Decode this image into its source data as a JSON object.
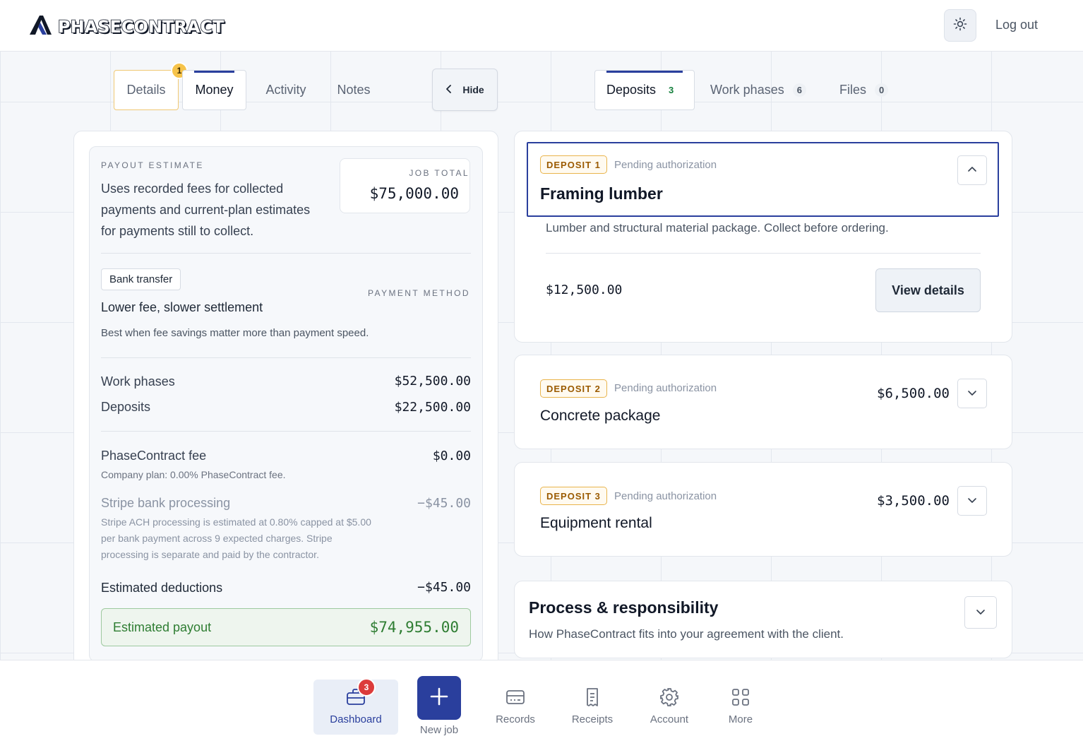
{
  "header": {
    "brand": "PHASECONTRACT",
    "logout": "Log out"
  },
  "left_tabs": {
    "details": "Details",
    "details_badge": "1",
    "money": "Money",
    "activity": "Activity",
    "notes": "Notes"
  },
  "hide_label": "Hide",
  "right_tabs": {
    "deposits": "Deposits",
    "deposits_count": "3",
    "work_phases": "Work phases",
    "work_phases_count": "6",
    "files": "Files",
    "files_count": "0"
  },
  "estimate": {
    "eyebrow": "PAYOUT ESTIMATE",
    "desc_1": "Uses recorded fees for collected",
    "desc_2": "payments and current-plan estimates",
    "desc_3": "for payments still to collect.",
    "job_total_label": "JOB TOTAL",
    "job_total": "$75,000.00",
    "method_chip": "Bank transfer",
    "method_eyebrow": "PAYMENT METHOD",
    "method_title": "Lower fee, slower settlement",
    "method_desc": "Best when fee savings matter more than payment speed.",
    "work_phases_label": "Work phases",
    "work_phases_value": "$52,500.00",
    "deposits_label": "Deposits",
    "deposits_value": "$22,500.00",
    "fee_label": "PhaseContract fee",
    "fee_value": "$0.00",
    "fee_note": "Company plan: 0.00% PhaseContract fee.",
    "stripe_label": "Stripe bank processing",
    "stripe_value": "−$45.00",
    "stripe_note_1": "Stripe ACH processing is estimated at 0.80% capped at $5.00",
    "stripe_note_2": "per bank payment across 9 expected charges. Stripe",
    "stripe_note_3": "processing is separate and paid by the contractor.",
    "deductions_label": "Estimated deductions",
    "deductions_value": "−$45.00",
    "payout_label": "Estimated payout",
    "payout_value": "$74,955.00"
  },
  "deposits": [
    {
      "tag": "DEPOSIT 1",
      "status": "Pending authorization",
      "title": "Framing lumber",
      "description": "Lumber and structural material package. Collect before ordering.",
      "amount": "$12,500.00",
      "action": "View details"
    },
    {
      "tag": "DEPOSIT 2",
      "status": "Pending authorization",
      "title": "Concrete package",
      "amount": "$6,500.00"
    },
    {
      "tag": "DEPOSIT 3",
      "status": "Pending authorization",
      "title": "Equipment rental",
      "amount": "$3,500.00"
    }
  ],
  "process": {
    "title": "Process & responsibility",
    "desc": "How PhaseContract fits into your agreement with the client."
  },
  "bottom_nav": {
    "dashboard": "Dashboard",
    "dashboard_badge": "3",
    "new_job": "New job",
    "records": "Records",
    "receipts": "Receipts",
    "account": "Account",
    "more": "More"
  },
  "colors": {
    "accent": "#2a3f9d",
    "warning": "#f6c34a",
    "success": "#2e7d32",
    "danger": "#dc3b3b"
  },
  "icons": [
    "logo-icon",
    "sun-icon",
    "chevron-left-icon",
    "chevron-up-icon",
    "chevron-down-icon",
    "briefcase-icon",
    "plus-icon",
    "card-icon",
    "receipt-icon",
    "gear-icon",
    "grid-icon"
  ]
}
